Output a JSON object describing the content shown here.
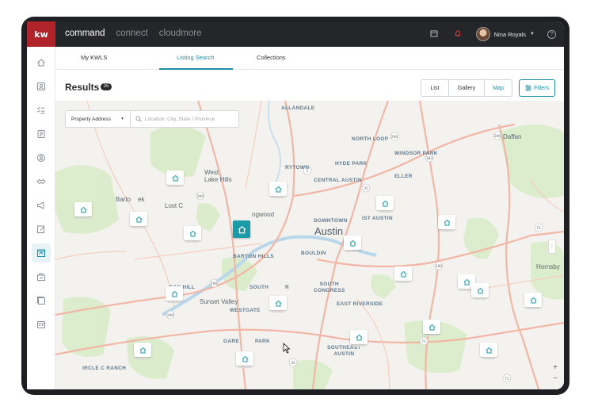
{
  "brand": {
    "logo": "kw",
    "accent": "#b0232a",
    "teal": "#1b8ea6"
  },
  "app_tabs": [
    "command",
    "connect",
    "cloudmore"
  ],
  "active_app": "command",
  "header_icons": [
    "store-icon",
    "notification-bell-icon",
    "help-icon"
  ],
  "user": {
    "name": "Nina Royals"
  },
  "sidebar": {
    "items": [
      "home-icon",
      "contacts-icon",
      "tasks-icon",
      "checklist-icon",
      "people-icon",
      "deals-icon",
      "marketing-icon",
      "edit-icon",
      "listings-icon",
      "mail-icon",
      "pages-icon",
      "calendar-icon"
    ],
    "active_index": 8
  },
  "subtabs": [
    "My KWLS",
    "Listing Search",
    "Collections"
  ],
  "active_subtab": "Listing Search",
  "results": {
    "title": "Results",
    "count": "25"
  },
  "view_toggle": [
    "List",
    "Gallery",
    "Map"
  ],
  "active_view": "Map",
  "filters_label": "Filters",
  "search": {
    "type": "Property Address",
    "placeholder": "Location: City, State / Province"
  },
  "map_labels": {
    "allandale": "ALLANDALE",
    "north_loop": "NORTH LOOP",
    "windsor_park": "WINDSOR PARK",
    "daffan": "Daffan",
    "rytown": "RYTOWN",
    "hyde_park": "HYDE PARK",
    "central_austin": "CENTRAL AUSTIN",
    "eller": "ELLER",
    "west_lake_hills": "West\nLake Hills",
    "barton_creek": "Barto    ek",
    "lost_c": "Lost C",
    "rollingwood": "ngwood",
    "downtown": "DOWNTOWN",
    "ist_austin": "IST AUSTIN",
    "austin": "Austin",
    "barton_hills": "BARTON HILLS",
    "bouldin": "BOULDIN",
    "hornsby": "Hornsby",
    "oak_hill": "OAK HILL",
    "south": "SOUTH",
    "south_r": "R",
    "south_congress": "SOUTH\nCONGRESS",
    "sunset_valley": "Sunset Valley",
    "westgate": "WESTGATE",
    "east_riverside": "EAST RIVERSIDE",
    "gare": "GARE",
    "park": "PARK",
    "southeast_austin": "SOUTHEAST\nAUSTIN",
    "circle_c_ranch": "IRCLE C RANCH"
  },
  "route_shields": [
    "290",
    "183",
    "35",
    "1",
    "360",
    "290",
    "71",
    "183",
    "71",
    "35",
    "290",
    "290",
    "71"
  ],
  "listing_pins_count": 20,
  "selected_pin_index": 5
}
